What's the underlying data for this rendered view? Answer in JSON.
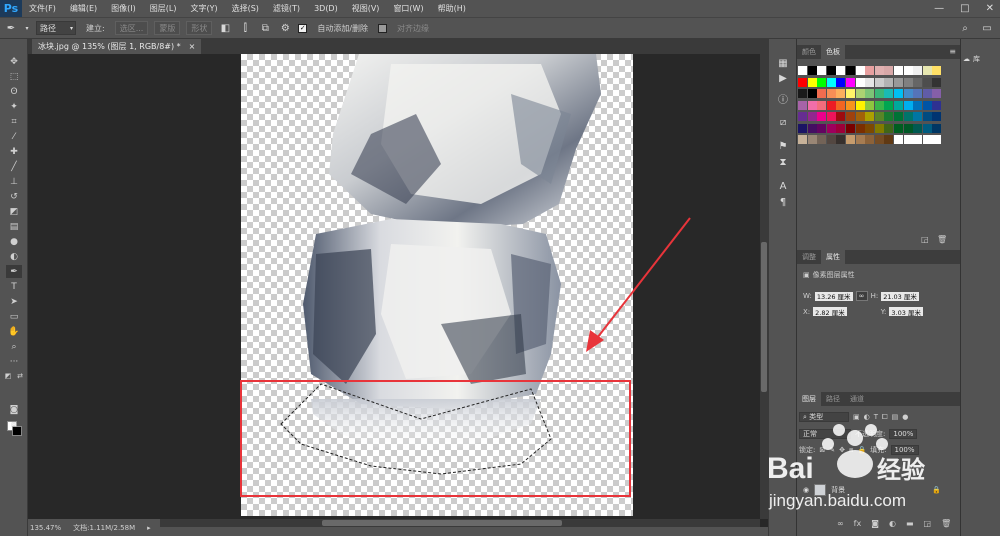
{
  "app": {
    "logo": "Ps",
    "menus": [
      "文件(F)",
      "编辑(E)",
      "图像(I)",
      "图层(L)",
      "文字(Y)",
      "选择(S)",
      "滤镜(T)",
      "3D(D)",
      "视图(V)",
      "窗口(W)",
      "帮助(H)"
    ],
    "window_controls": [
      "—",
      "□",
      "✕"
    ]
  },
  "options_bar": {
    "tool_mode": "路径",
    "make_label": "建立:",
    "selection_btn": "选区...",
    "mask_btn": "蒙版",
    "shape_btn": "形状",
    "auto_add_label": "自动添加/删除",
    "align_edges_label": "对齐边缘"
  },
  "document": {
    "tab_title": "冰块.jpg @ 135% (图层 1, RGB/8#) *",
    "close_glyph": "×",
    "zoom": "135.47%",
    "doc_size": "文档:1.11M/2.58M"
  },
  "panels": {
    "color_tabs": [
      "颜色",
      "色板"
    ],
    "props_tabs": [
      "调整",
      "属性"
    ],
    "props_title": "像素图层属性",
    "w_label": "W:",
    "w_value": "13.26 厘米",
    "h_label": "H:",
    "h_value": "21.03 厘米",
    "x_label": "X:",
    "x_value": "2.82 厘米",
    "y_label": "Y:",
    "y_value": "3.03 厘米",
    "layers_tabs": [
      "图层",
      "路径",
      "通道"
    ],
    "filter_kind": "类型",
    "blend_mode": "正常",
    "opacity_label": "不透明度:",
    "opacity_value": "100%",
    "lock_label": "锁定:",
    "fill_label": "填充:",
    "fill_value": "100%",
    "background_layer": "背景",
    "library_label": "库"
  },
  "watermark": {
    "brand": "Bai",
    "brand2": "经验",
    "url": "jingyan.baidu.com"
  },
  "colors": {
    "selection_box": "#e8343a",
    "arrow": "#e8343a",
    "accent": "#31a8ff"
  }
}
